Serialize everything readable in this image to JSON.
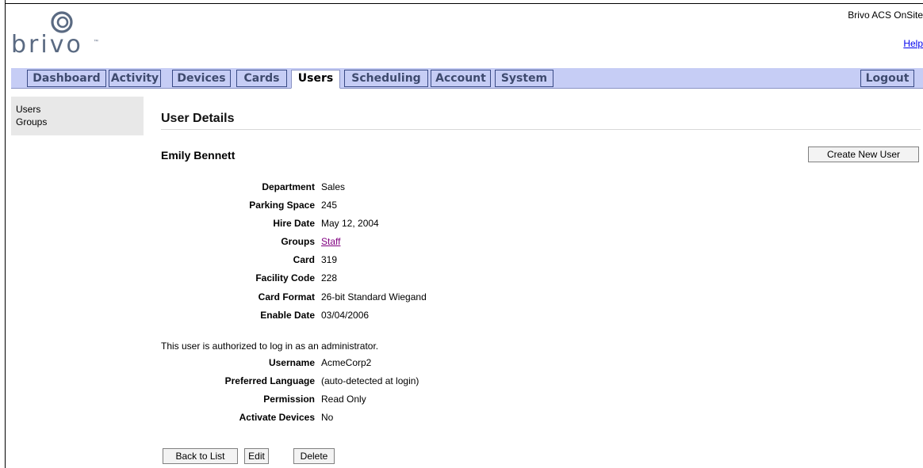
{
  "header": {
    "brand": "brivo",
    "trademark": "™",
    "app_title": "Brivo ACS OnSite",
    "help_label": "Help"
  },
  "nav": {
    "tabs": [
      {
        "label": "Dashboard",
        "active": false
      },
      {
        "label": "Activity",
        "active": false
      },
      {
        "label": "Devices",
        "active": false
      },
      {
        "label": "Cards",
        "active": false
      },
      {
        "label": "Users",
        "active": true
      },
      {
        "label": "Scheduling",
        "active": false
      },
      {
        "label": "Account",
        "active": false
      },
      {
        "label": "System",
        "active": false
      }
    ],
    "logout_label": "Logout"
  },
  "sidebar": {
    "items": [
      {
        "label": "Users"
      },
      {
        "label": "Groups"
      }
    ]
  },
  "main": {
    "title": "User Details",
    "user_name": "Emily Bennett",
    "create_button": "Create New User",
    "details": [
      {
        "label": "Department",
        "value": "Sales"
      },
      {
        "label": "Parking Space",
        "value": "245"
      },
      {
        "label": "Hire Date",
        "value": "May 12, 2004"
      },
      {
        "label": "Groups",
        "value": "Staff"
      },
      {
        "label": "Card",
        "value": "319"
      },
      {
        "label": "Facility Code",
        "value": "228"
      },
      {
        "label": "Card Format",
        "value": "26-bit Standard Wiegand"
      },
      {
        "label": "Enable Date",
        "value": "03/04/2006"
      }
    ],
    "admin_note": "This user is authorized to log in as an administrator.",
    "admin_details": [
      {
        "label": "Username",
        "value": "AcmeCorp2"
      },
      {
        "label": "Preferred Language",
        "value": "(auto-detected at login)"
      },
      {
        "label": "Permission",
        "value": "Read Only"
      },
      {
        "label": "Activate Devices",
        "value": "No"
      }
    ],
    "buttons": {
      "back": "Back to List",
      "edit": "Edit",
      "delete": "Delete"
    }
  },
  "colors": {
    "nav_bg": "#c6cdf5",
    "nav_border": "#3a4b86",
    "logo": "#5a6a82",
    "link_visited": "#800080",
    "link": "#0000ee"
  }
}
